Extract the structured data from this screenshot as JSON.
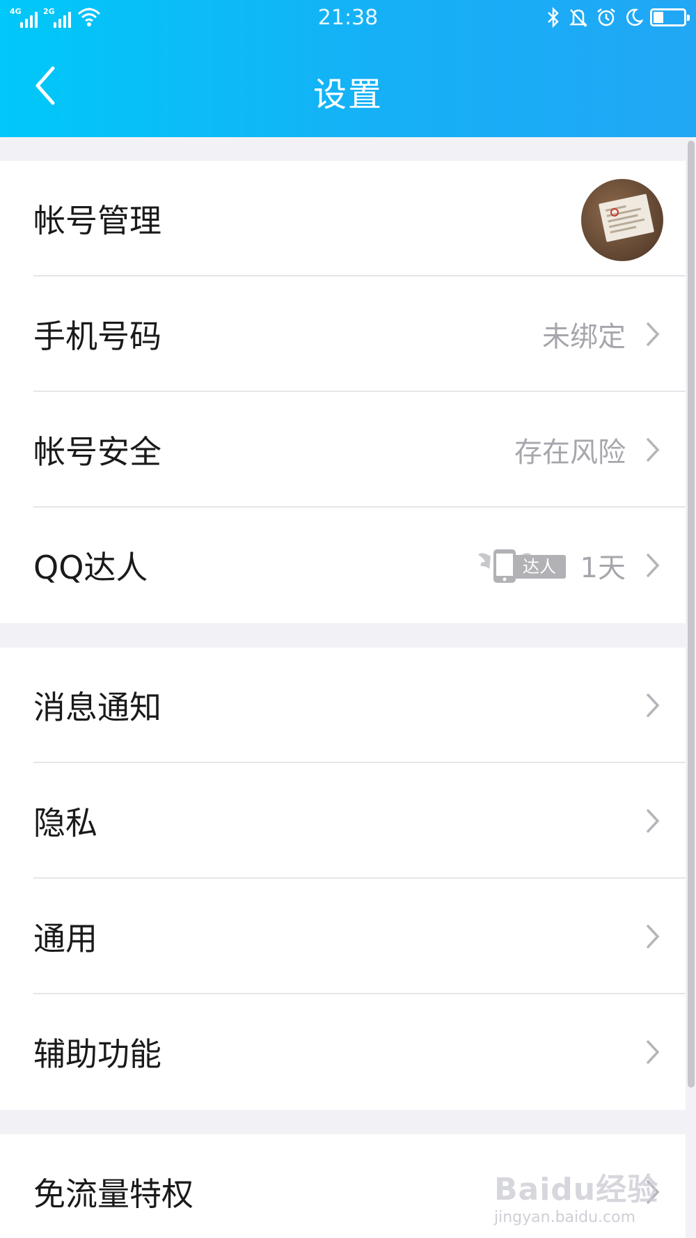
{
  "status_bar": {
    "network_1": "4G",
    "network_2": "2G",
    "time": "21:38",
    "icons": [
      "signal-4g-icon",
      "signal-2g-icon",
      "wifi-icon",
      "bluetooth-icon",
      "mute-bell-icon",
      "alarm-icon",
      "moon-icon",
      "battery-icon"
    ],
    "battery_level": 0.25
  },
  "nav": {
    "title": "设置",
    "back_icon": "chevron-left-icon"
  },
  "groups": [
    {
      "rows": [
        {
          "label": "帐号管理",
          "trailing": "avatar"
        },
        {
          "label": "手机号码",
          "value": "未绑定"
        },
        {
          "label": "帐号安全",
          "value": "存在风险"
        },
        {
          "label": "QQ达人",
          "badge": "达人",
          "value": "1天"
        }
      ]
    },
    {
      "rows": [
        {
          "label": "消息通知"
        },
        {
          "label": "隐私"
        },
        {
          "label": "通用"
        },
        {
          "label": "辅助功能"
        }
      ]
    },
    {
      "rows": [
        {
          "label": "免流量特权"
        }
      ]
    }
  ],
  "watermark": {
    "logo_text": "Baidu经验",
    "url": "jingyan.baidu.com"
  },
  "colors": {
    "header_start": "#00c8f8",
    "header_end": "#21a7f5",
    "page_bg": "#f2f2f6",
    "row_label": "#1a1a1a",
    "row_value": "#a6a6ad"
  }
}
